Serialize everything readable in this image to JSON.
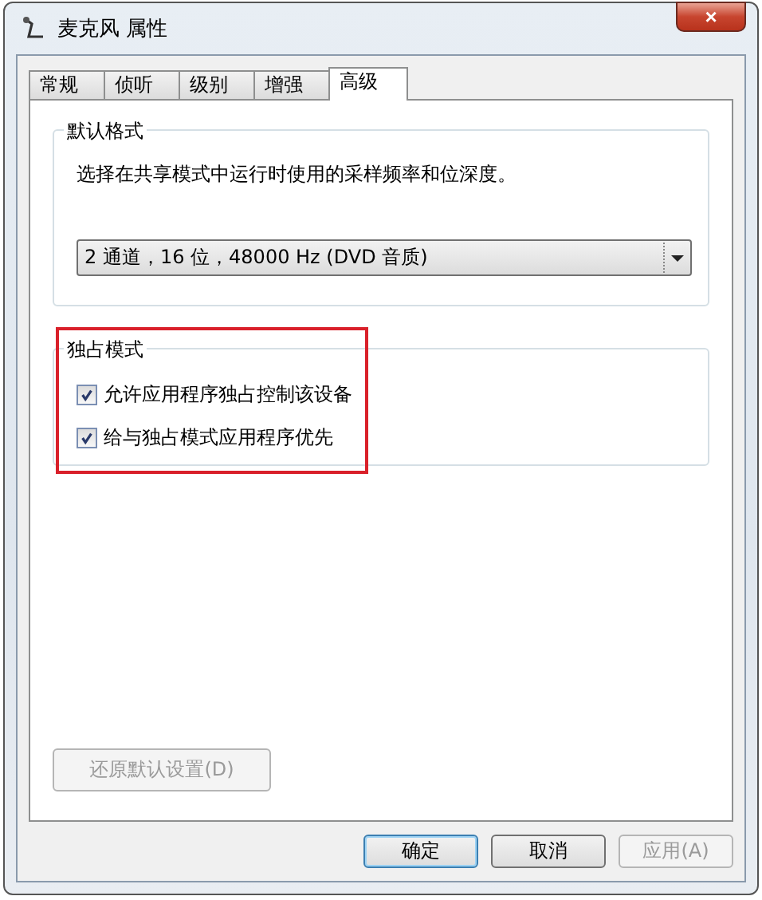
{
  "window": {
    "title": "麦克风 属性",
    "close": "×"
  },
  "tabs": [
    {
      "label": "常规",
      "selected": false
    },
    {
      "label": "侦听",
      "selected": false
    },
    {
      "label": "级别",
      "selected": false
    },
    {
      "label": "增强",
      "selected": false
    },
    {
      "label": "高级",
      "selected": true
    }
  ],
  "default_format": {
    "title": "默认格式",
    "description": "选择在共享模式中运行时使用的采样频率和位深度。",
    "dropdown": {
      "value": "2 通道，16 位，48000 Hz (DVD 音质)"
    }
  },
  "exclusive_mode": {
    "title": "独占模式",
    "highlighted": true,
    "options": [
      {
        "label": "允许应用程序独占控制该设备",
        "checked": true
      },
      {
        "label": "给与独占模式应用程序优先",
        "checked": true
      }
    ]
  },
  "restore_button": {
    "label": "还原默认设置(D)",
    "disabled": true
  },
  "buttons": [
    {
      "label": "确定",
      "default": true,
      "disabled": false
    },
    {
      "label": "取消",
      "default": false,
      "disabled": false
    },
    {
      "label": "应用(A)",
      "default": false,
      "disabled": true
    }
  ]
}
